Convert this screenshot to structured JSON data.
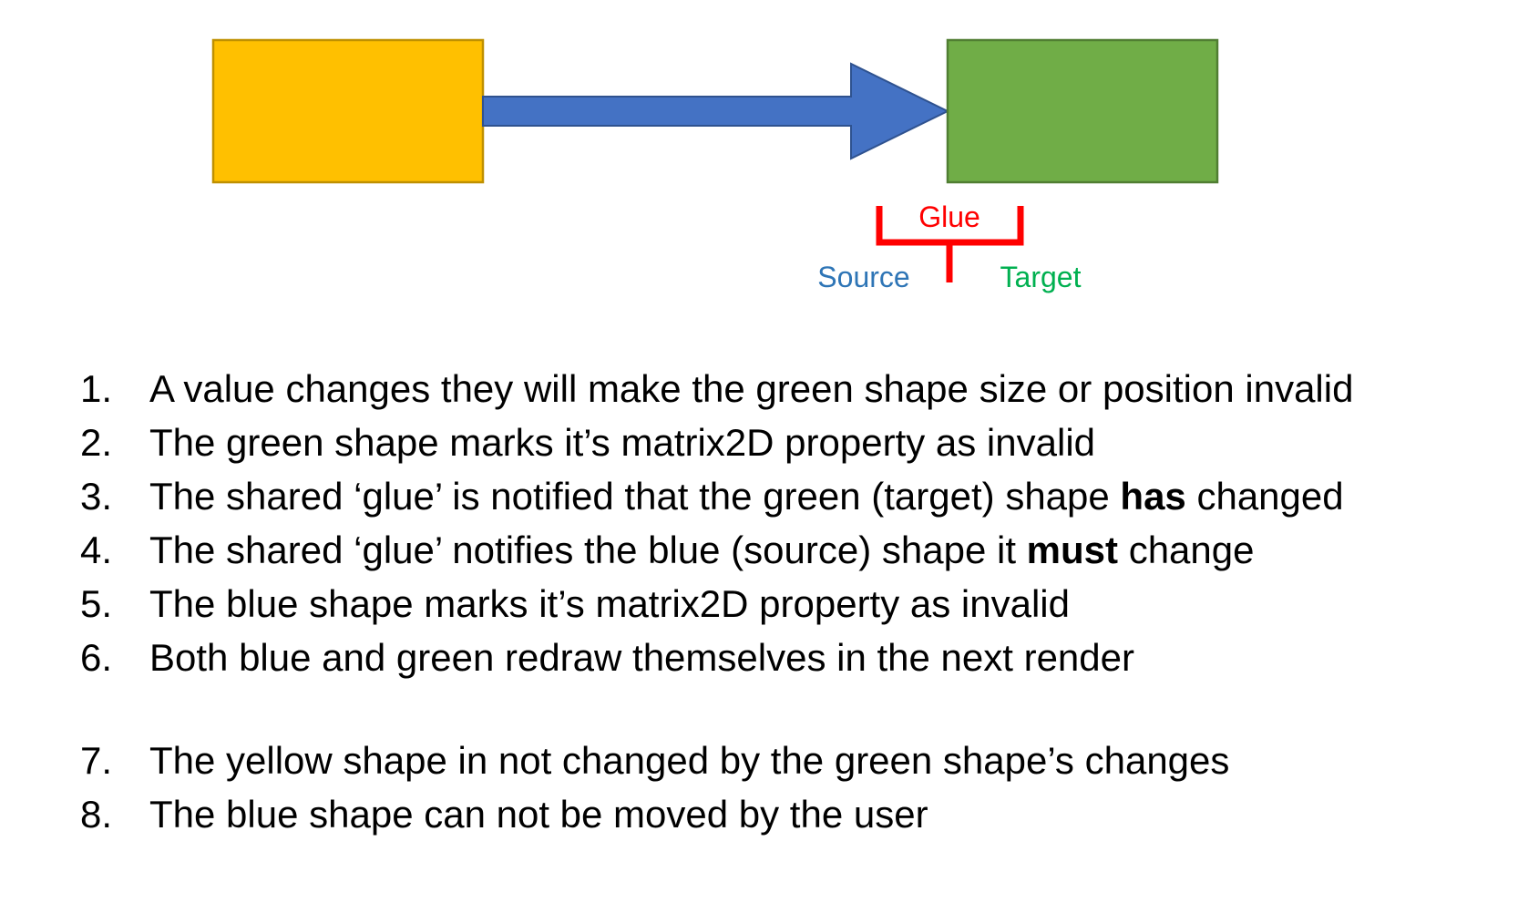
{
  "diagram": {
    "colors": {
      "yellow_fill": "#FFC000",
      "yellow_stroke": "#BF9000",
      "green_fill": "#70AD47",
      "green_stroke": "#507E32",
      "arrow_fill": "#4472C4",
      "arrow_stroke": "#2F528F",
      "glue_color": "#FF0000",
      "source_color": "#2E75B6",
      "target_color": "#00B050"
    },
    "labels": {
      "glue": "Glue",
      "source": "Source",
      "target": "Target"
    }
  },
  "steps": [
    {
      "num": "1.",
      "before": "A value changes they will make the green shape size or position invalid",
      "bold": "",
      "after": ""
    },
    {
      "num": "2.",
      "before": "The green shape marks it’s matrix2D property as invalid",
      "bold": "",
      "after": ""
    },
    {
      "num": "3.",
      "before": "The shared ‘glue’ is notified that the green (target) shape ",
      "bold": "has",
      "after": " changed"
    },
    {
      "num": "4.",
      "before": "The shared ‘glue’ notifies the blue (source) shape it ",
      "bold": "must",
      "after": " change"
    },
    {
      "num": "5.",
      "before": "The blue shape marks it’s matrix2D property as invalid",
      "bold": "",
      "after": ""
    },
    {
      "num": "6.",
      "before": "Both blue and green redraw themselves in the next render",
      "bold": "",
      "after": ""
    },
    {
      "num": "7.",
      "before": "The yellow shape in not changed by the green shape’s changes",
      "bold": "",
      "after": ""
    },
    {
      "num": "8.",
      "before": "The blue shape can not be moved by the user",
      "bold": "",
      "after": ""
    }
  ]
}
